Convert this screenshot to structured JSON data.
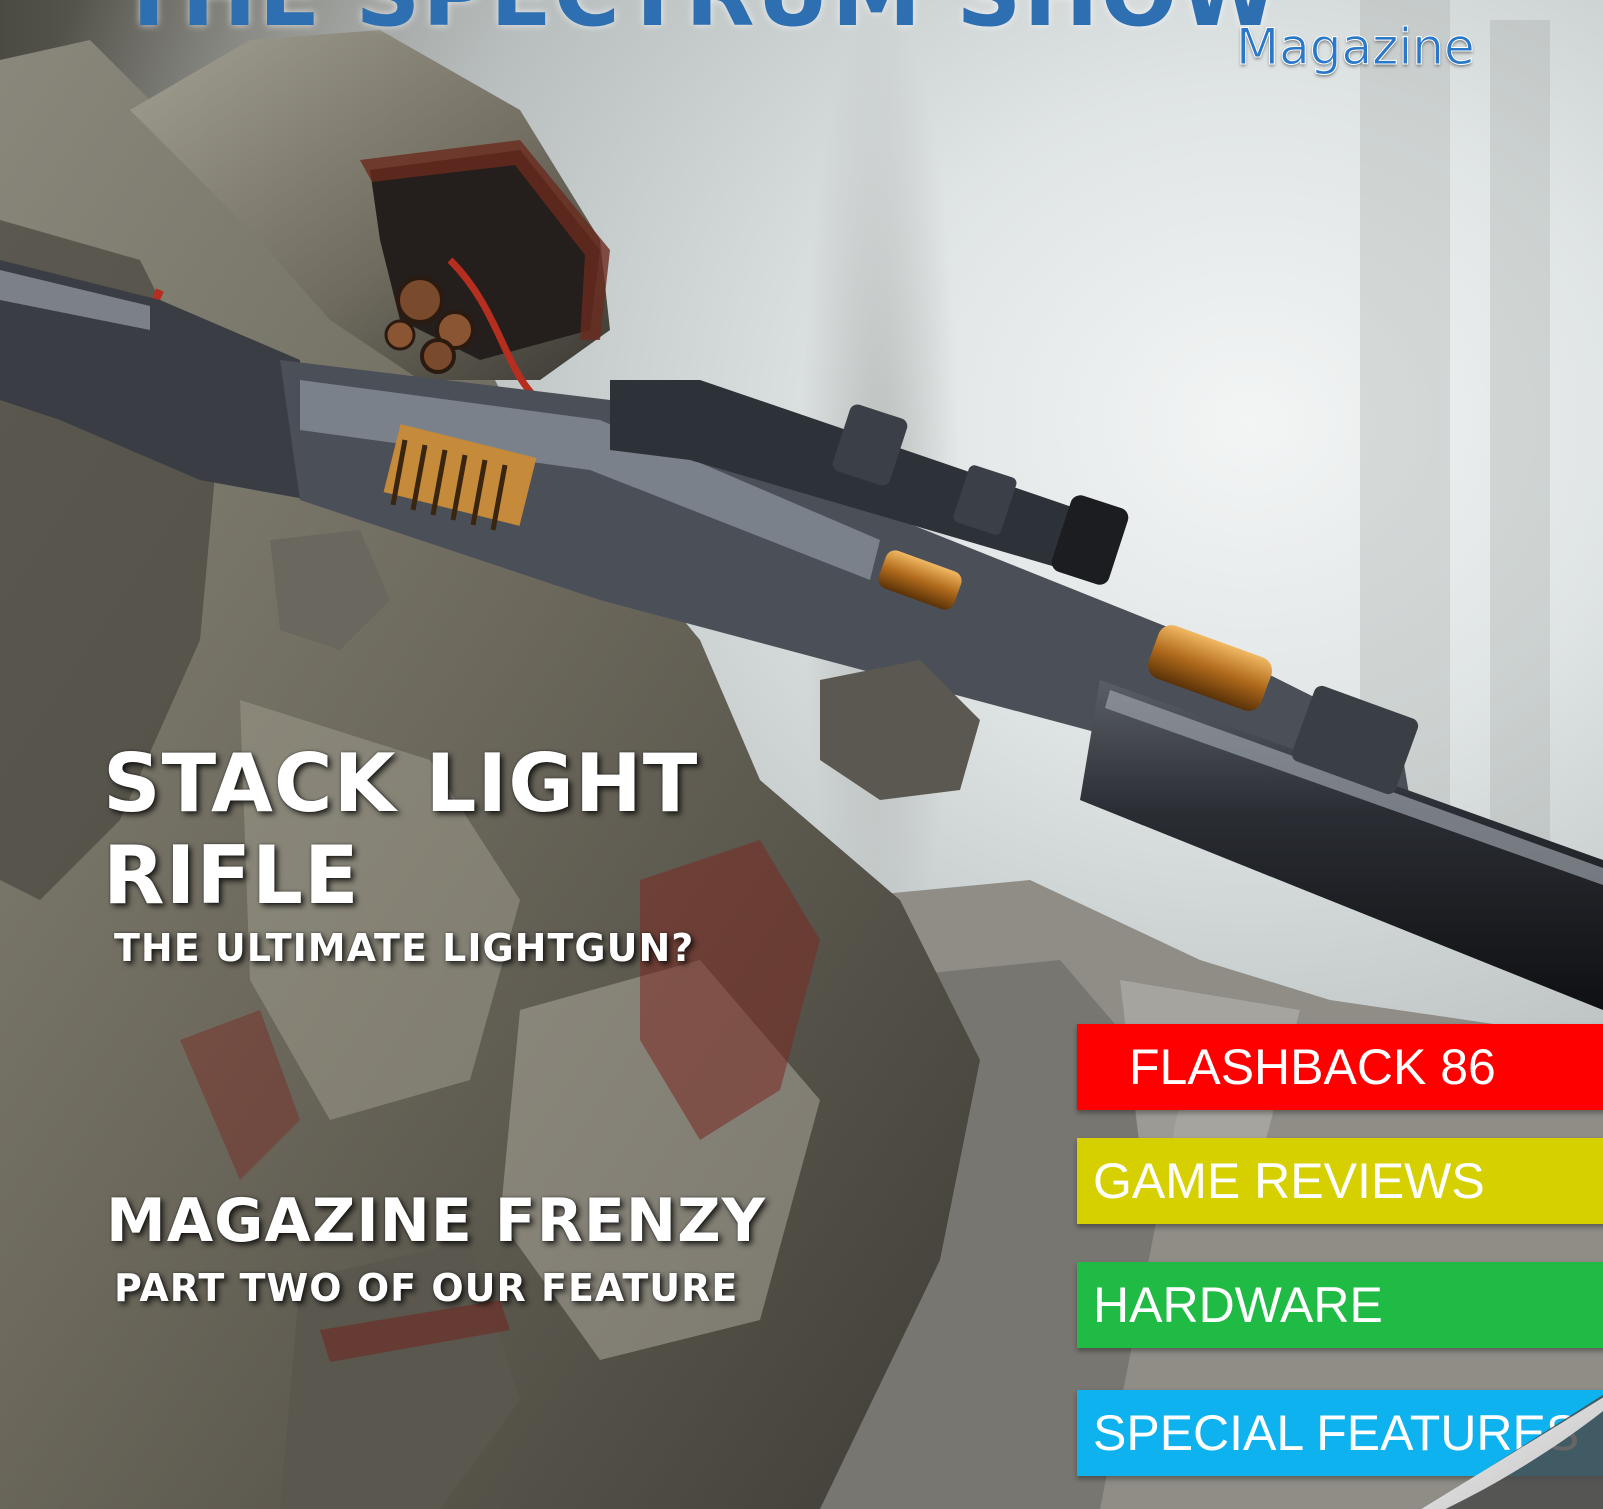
{
  "masthead": {
    "title": "THE SPECTRUM SHOW",
    "subtitle": "Magazine"
  },
  "stories": [
    {
      "headline": "STACK LIGHT RIFLE",
      "subheadline": "THE ULTIMATE LIGHTGUN?"
    },
    {
      "headline": "MAGAZINE FRENZY",
      "subheadline": "PART TWO OF OUR FEATURE"
    }
  ],
  "section_tags": [
    {
      "label": "FLASHBACK 86",
      "color": "#ff0000"
    },
    {
      "label": "GAME REVIEWS",
      "color": "#d6d000"
    },
    {
      "label": "HARDWARE",
      "color": "#20bb45"
    },
    {
      "label": "SPECIAL FEATURES",
      "color": "#0db2ef"
    }
  ],
  "artwork": {
    "subject": "hooded-sniper-with-scoped-rifle"
  },
  "colors": {
    "masthead_blue": "#2e6fb2",
    "headline_white": "#ffffff"
  }
}
